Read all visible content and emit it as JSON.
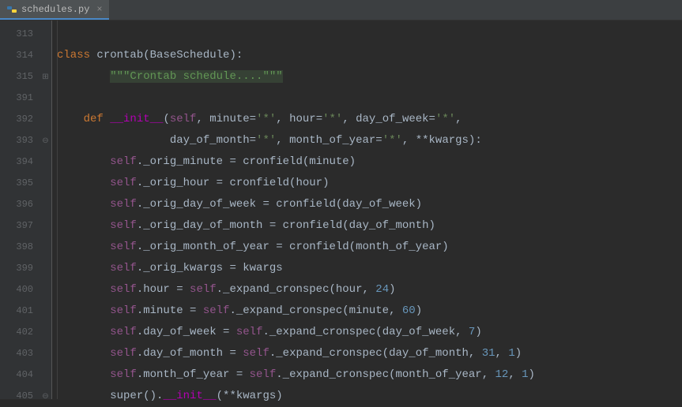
{
  "tab": {
    "filename": "schedules.py",
    "close": "×"
  },
  "line_numbers": [
    "313",
    "314",
    "315",
    "391",
    "392",
    "393",
    "394",
    "395",
    "396",
    "397",
    "398",
    "399",
    "400",
    "401",
    "402",
    "403",
    "404",
    "405"
  ],
  "fold_markers": [
    "",
    "",
    "⊞",
    "",
    "",
    "⊖",
    "",
    "",
    "",
    "",
    "",
    "",
    "",
    "",
    "",
    "",
    "",
    "⊖"
  ],
  "code": {
    "l0": "",
    "l1_kw": "class ",
    "l1_name": "crontab",
    "l1_paren_open": "(",
    "l1_base": "BaseSchedule",
    "l1_paren_close": "):",
    "l2_indent": "        ",
    "l2_doc": "\"\"\"Crontab schedule....\"\"\"",
    "l3": "",
    "l4_indent": "    ",
    "l4_def": "def ",
    "l4_name": "__init__",
    "l4_p1": "(",
    "l4_self": "self",
    "l4_c1": ", minute=",
    "l4_s1": "'*'",
    "l4_c2": ", hour=",
    "l4_s2": "'*'",
    "l4_c3": ", day_of_week=",
    "l4_s3": "'*'",
    "l4_c4": ",",
    "l5_indent": "                 ",
    "l5_p1": "day_of_month=",
    "l5_s1": "'*'",
    "l5_c1": ", month_of_year=",
    "l5_s2": "'*'",
    "l5_c2": ", **kwargs):",
    "l6_indent": "        ",
    "l6_self": "self",
    "l6_rest": "._orig_minute = cronfield(minute)",
    "l7_indent": "        ",
    "l7_self": "self",
    "l7_rest": "._orig_hour = cronfield(hour)",
    "l8_indent": "        ",
    "l8_self": "self",
    "l8_rest": "._orig_day_of_week = cronfield(day_of_week)",
    "l9_indent": "        ",
    "l9_self": "self",
    "l9_rest": "._orig_day_of_month = cronfield(day_of_month)",
    "l10_indent": "        ",
    "l10_self": "self",
    "l10_rest": "._orig_month_of_year = cronfield(month_of_year)",
    "l11_indent": "        ",
    "l11_self": "self",
    "l11_rest": "._orig_kwargs = kwargs",
    "l12_indent": "        ",
    "l12_self": "self",
    "l12_dot": ".hour = ",
    "l12_self2": "self",
    "l12_call": "._expand_cronspec(hour, ",
    "l12_n": "24",
    "l12_end": ")",
    "l13_indent": "        ",
    "l13_self": "self",
    "l13_dot": ".minute = ",
    "l13_self2": "self",
    "l13_call": "._expand_cronspec(minute, ",
    "l13_n": "60",
    "l13_end": ")",
    "l14_indent": "        ",
    "l14_self": "self",
    "l14_dot": ".day_of_week = ",
    "l14_self2": "self",
    "l14_call": "._expand_cronspec(day_of_week, ",
    "l14_n": "7",
    "l14_end": ")",
    "l15_indent": "        ",
    "l15_self": "self",
    "l15_dot": ".day_of_month = ",
    "l15_self2": "self",
    "l15_call": "._expand_cronspec(day_of_month, ",
    "l15_n1": "31",
    "l15_c": ", ",
    "l15_n2": "1",
    "l15_end": ")",
    "l16_indent": "        ",
    "l16_self": "self",
    "l16_dot": ".month_of_year = ",
    "l16_self2": "self",
    "l16_call": "._expand_cronspec(month_of_year, ",
    "l16_n1": "12",
    "l16_c": ", ",
    "l16_n2": "1",
    "l16_end": ")",
    "l17_indent": "        ",
    "l17_super": "super().",
    "l17_init": "__init__",
    "l17_end": "(**kwargs)"
  }
}
